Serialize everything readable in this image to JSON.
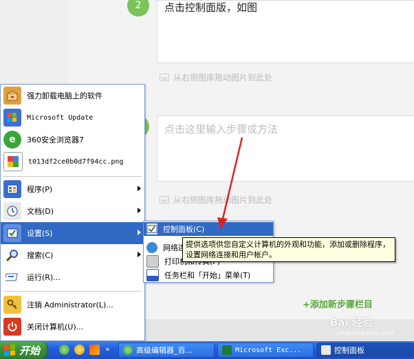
{
  "editor": {
    "step2_number": "2",
    "step2_text": "点击控制面版，如图",
    "step3_placeholder": "点击这里输入步骤或方法",
    "drag_hint": "从右侧图库拖动图片到此处",
    "add_step": "+添加新步骤栏目"
  },
  "start_menu": {
    "pinned": [
      {
        "label": "强力卸载电脑上的软件",
        "icon": "uninstall-box-icon"
      },
      {
        "label": "Microsoft Update",
        "icon": "windows-update-icon"
      },
      {
        "label": "360安全浏览器7",
        "icon": "360-browser-icon"
      },
      {
        "label": "t013df2ce0b0d7f94cc.png",
        "icon": "image-file-icon"
      }
    ],
    "items": [
      {
        "label": "程序(P)",
        "icon": "programs-icon"
      },
      {
        "label": "文档(D)",
        "icon": "documents-icon"
      },
      {
        "label": "设置(S)",
        "icon": "settings-icon"
      },
      {
        "label": "搜索(C)",
        "icon": "search-icon"
      },
      {
        "label": "运行(R)...",
        "icon": "run-icon"
      },
      {
        "label": "注销 Administrator(L)...",
        "icon": "logoff-key-icon"
      },
      {
        "label": "关闭计算机(U)...",
        "icon": "shutdown-icon"
      }
    ]
  },
  "submenu": {
    "items": [
      {
        "label": "控制面板(C)",
        "icon": "control-panel-icon"
      },
      {
        "label": "网络连接(N)",
        "icon": "network-icon"
      },
      {
        "label": "打印机和传真(P)",
        "icon": "printer-icon"
      },
      {
        "label": "任务栏和「开始」菜单(T)",
        "icon": "taskbar-icon"
      }
    ]
  },
  "tooltip": {
    "text": "提供选项供您自定义计算机的外观和功能，添加或删除程序，设置网络连接和用户帐户。"
  },
  "taskbar": {
    "start_label": "开始",
    "chevron": "»",
    "tasks": [
      {
        "label": "高级编辑器_百...",
        "icon": "browser-icon"
      },
      {
        "label": "Microsoft Exc...",
        "icon": "excel-icon"
      },
      {
        "label": "控制面板",
        "icon": "control-panel-icon"
      }
    ]
  },
  "watermark": {
    "text": "Bai 经验",
    "sub": "jingyan.baidu.com"
  },
  "colors": {
    "menu_highlight": "#316ac5",
    "taskbar_blue": "#245edb",
    "start_green": "#3a8f3a",
    "step_green": "#7cc35a",
    "tooltip_bg": "#ffffe1",
    "arrow_red": "#e02020"
  }
}
